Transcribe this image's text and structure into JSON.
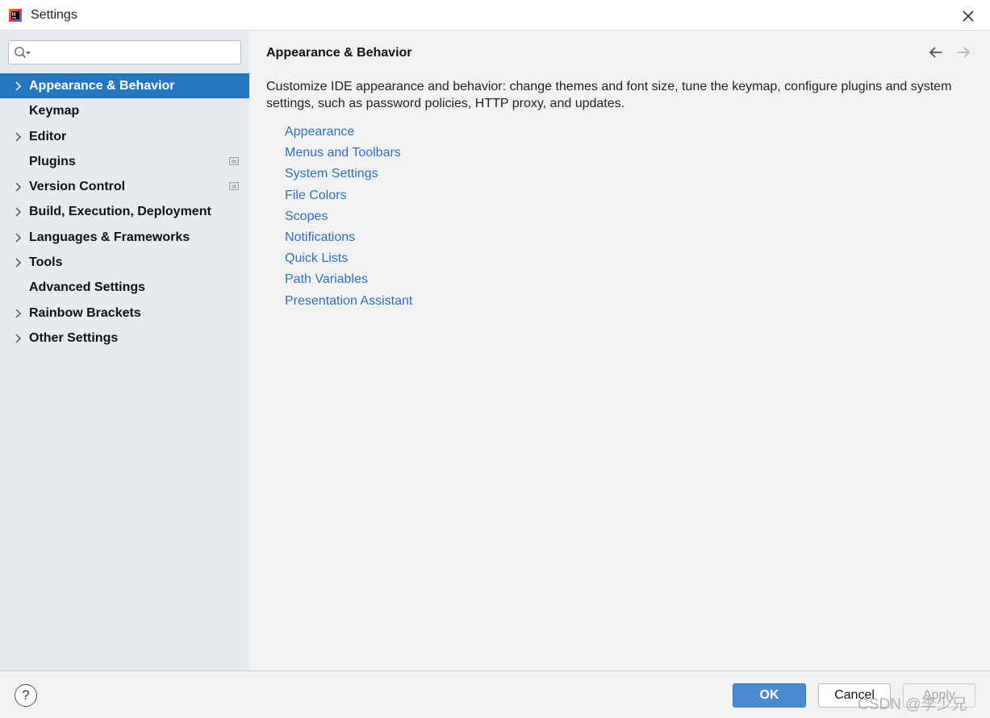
{
  "window": {
    "title": "Settings"
  },
  "search": {
    "placeholder": ""
  },
  "sidebar": {
    "items": [
      {
        "label": "Appearance & Behavior",
        "expandable": true,
        "selected": true,
        "project_icon": false
      },
      {
        "label": "Keymap",
        "expandable": false,
        "selected": false,
        "project_icon": false
      },
      {
        "label": "Editor",
        "expandable": true,
        "selected": false,
        "project_icon": false
      },
      {
        "label": "Plugins",
        "expandable": false,
        "selected": false,
        "project_icon": true
      },
      {
        "label": "Version Control",
        "expandable": true,
        "selected": false,
        "project_icon": true
      },
      {
        "label": "Build, Execution, Deployment",
        "expandable": true,
        "selected": false,
        "project_icon": false
      },
      {
        "label": "Languages & Frameworks",
        "expandable": true,
        "selected": false,
        "project_icon": false
      },
      {
        "label": "Tools",
        "expandable": true,
        "selected": false,
        "project_icon": false
      },
      {
        "label": "Advanced Settings",
        "expandable": false,
        "selected": false,
        "project_icon": false
      },
      {
        "label": "Rainbow Brackets",
        "expandable": true,
        "selected": false,
        "project_icon": false
      },
      {
        "label": "Other Settings",
        "expandable": true,
        "selected": false,
        "project_icon": false
      }
    ]
  },
  "main": {
    "title": "Appearance & Behavior",
    "description": "Customize IDE appearance and behavior: change themes and font size, tune the keymap, configure plugins and system settings, such as password policies, HTTP proxy, and updates.",
    "links": [
      "Appearance",
      "Menus and Toolbars",
      "System Settings",
      "File Colors",
      "Scopes",
      "Notifications",
      "Quick Lists",
      "Path Variables",
      "Presentation Assistant"
    ]
  },
  "footer": {
    "help_label": "?",
    "ok_label": "OK",
    "cancel_label": "Cancel",
    "apply_label": "Apply",
    "watermark": "CSDN @李少兄"
  },
  "colors": {
    "selection": "#2675bf",
    "link": "#2f6fb8",
    "sidebar_bg": "#e6ebf0",
    "ok_button": "#4b8ad0"
  }
}
